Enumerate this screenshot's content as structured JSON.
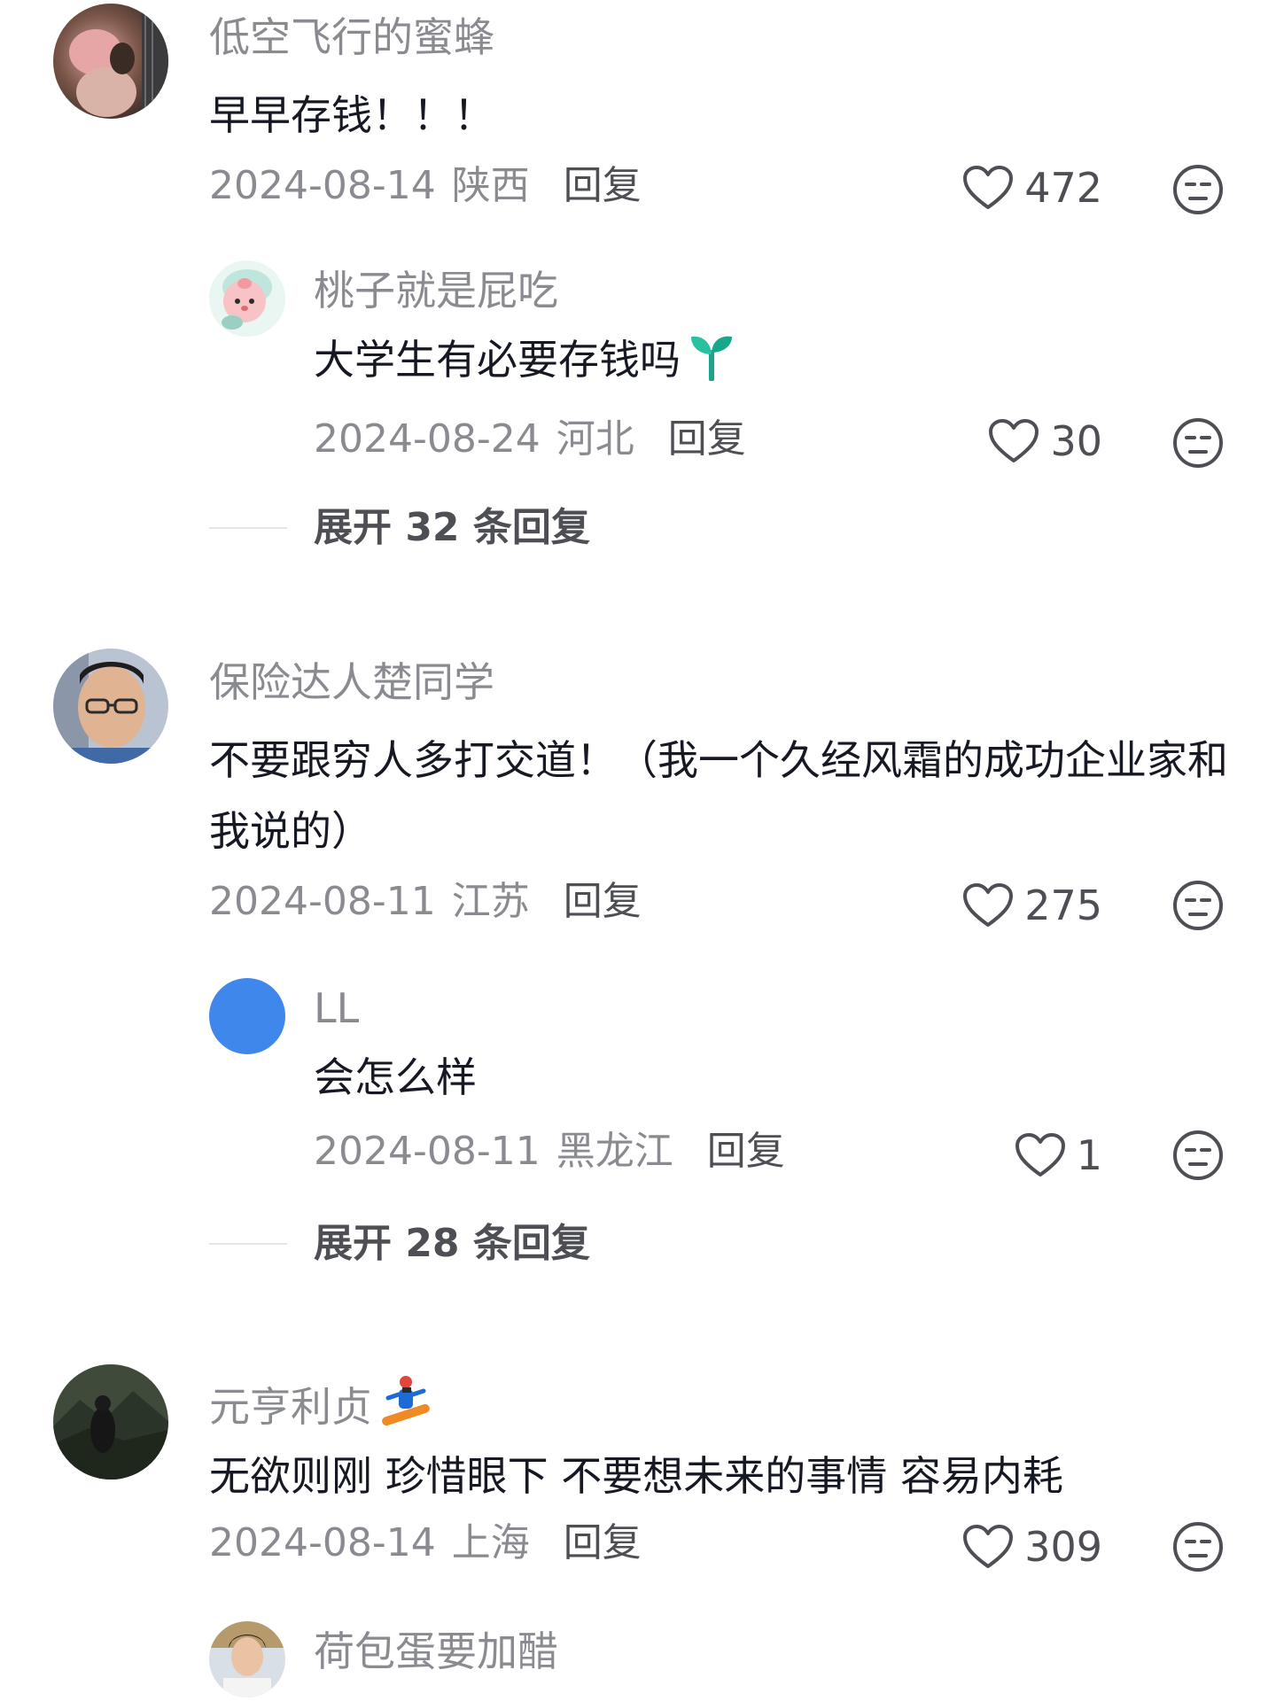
{
  "comments": [
    {
      "username": "低空飞行的蜜蜂",
      "text": "早早存钱！！！",
      "date": "2024-08-14",
      "location": "陕西",
      "reply_label": "回复",
      "likes": "472",
      "avatar_icon": "photo-avatar-bouquet",
      "replies": [
        {
          "username": "桃子就是屁吃",
          "text": "大学生有必要存钱吗",
          "text_emoji": "seedling-emoji",
          "date": "2024-08-24",
          "location": "河北",
          "reply_label": "回复",
          "likes": "30",
          "avatar_icon": "peach-cartoon-avatar"
        }
      ],
      "expand_label": "展开 32 条回复"
    },
    {
      "username": "保险达人楚同学",
      "text": "不要跟穷人多打交道！（我一个久经风霜的成功企业家和我说的）",
      "date": "2024-08-11",
      "location": "江苏",
      "reply_label": "回复",
      "likes": "275",
      "avatar_icon": "photo-avatar-man-glasses",
      "replies": [
        {
          "username": "LL",
          "text": "会怎么样",
          "date": "2024-08-11",
          "location": "黑龙江",
          "reply_label": "回复",
          "likes": "1",
          "avatar_icon": "blue-circle-avatar"
        }
      ],
      "expand_label": "展开 28 条回复"
    },
    {
      "username": "元亨利贞",
      "username_emoji": "snowboarder-emoji",
      "text": "无欲则刚 珍惜眼下 不要想未来的事情 容易内耗",
      "date": "2024-08-14",
      "location": "上海",
      "reply_label": "回复",
      "likes": "309",
      "avatar_icon": "photo-avatar-mountain",
      "replies": [
        {
          "username": "荷包蛋要加醋",
          "avatar_icon": "photo-avatar-woman"
        }
      ]
    }
  ],
  "colors": {
    "text_primary": "#161823",
    "text_secondary": "#8a8b91",
    "reply_button": "#4e4f55",
    "avatar_blue": "#3f87ea"
  }
}
